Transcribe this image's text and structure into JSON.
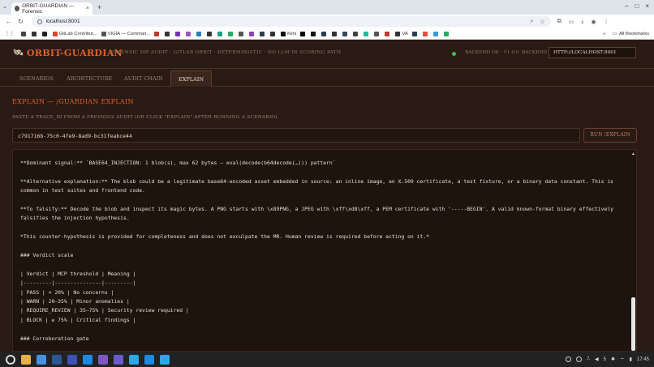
{
  "browser": {
    "tab_title": "ORBIT-GUARDIAN — Forensic",
    "new_tab": "+",
    "url": "localhost:8001",
    "bookmarks": [
      {
        "label": "",
        "color": "#444"
      },
      {
        "label": "",
        "color": "#333"
      },
      {
        "label": "",
        "color": "#222"
      },
      {
        "label": "GitLab Contribut...",
        "color": "#e24329"
      },
      {
        "label": "VIGÍA — Comman...",
        "color": "#555"
      },
      {
        "label": "",
        "color": "#c0392b"
      },
      {
        "label": "",
        "color": "#333"
      },
      {
        "label": "",
        "color": "#7b2fbf"
      },
      {
        "label": "",
        "color": "#9b59b6"
      },
      {
        "label": "",
        "color": "#2980b9"
      },
      {
        "label": "",
        "color": "#333"
      },
      {
        "label": "",
        "color": "#16a085"
      },
      {
        "label": "",
        "color": "#27ae60"
      },
      {
        "label": "",
        "color": "#555"
      },
      {
        "label": "",
        "color": "#8e44ad"
      },
      {
        "label": "",
        "color": "#2c3e50"
      },
      {
        "label": "",
        "color": "#333"
      },
      {
        "label": "Kimi",
        "color": "#111"
      },
      {
        "label": "",
        "color": "#000"
      },
      {
        "label": "",
        "color": "#111"
      },
      {
        "label": "",
        "color": "#2c3e50"
      },
      {
        "label": "",
        "color": "#333"
      },
      {
        "label": "",
        "color": "#34495e"
      },
      {
        "label": "",
        "color": "#444"
      },
      {
        "label": "",
        "color": "#1abc9c"
      },
      {
        "label": "",
        "color": "#555"
      },
      {
        "label": "",
        "color": "#c0392b"
      },
      {
        "label": "VA",
        "color": "#333"
      },
      {
        "label": "",
        "color": "#2c3e50"
      },
      {
        "label": "",
        "color": "#e74c3c"
      },
      {
        "label": "",
        "color": "#3498db"
      },
      {
        "label": "",
        "color": "#27ae60"
      }
    ],
    "all_bookmarks": "All Bookmarks"
  },
  "app": {
    "logo": "ORBIT-GUARDIAN",
    "subtitle": "FORENSIC MR AUDIT · GITLAB ORBIT · DETERMINISTIC · NO LLM IN SCORING PATH",
    "status": "BACKEND OK · V1.0.0",
    "backend_label": "BACKEND",
    "backend_url": "HTTP://LOCALHOST:8001",
    "tabs": [
      "SCENARIOS",
      "ARCHITECTURE",
      "AUDIT CHAIN",
      "EXPLAIN"
    ],
    "active_tab": "EXPLAIN"
  },
  "explain": {
    "title": "EXPLAIN — /GUARDIAN EXPLAIN",
    "hint": "PASTE A TRACE_ID FROM A PREVIOUS AUDIT (OR CLICK \"EXPLAIN\" AFTER RUNNING A SCENARIO).",
    "trace_id": "c791716b-75c0-4fe9-8ad9-bc31feabce44",
    "run_button": "RUN /EXPLAIN",
    "output": [
      "**Dominant signal:** `BASE64_INJECTION: 1 blob(s), max 62 bytes — eval(decode(b64decode(…))) pattern`",
      "",
      "**Alternative explanation:** The blob could be a legitimate base64-encoded asset embedded in source: an inline image, an X.509 certificate, a test fixture, or a binary data constant. This is common in test suites and frontend code.",
      "",
      "**To falsify:** Decode the blob and inspect its magic bytes. A PNG starts with \\x89PNG, a JPEG with \\xff\\xd8\\xff, a PEM certificate with '-----BEGIN'. A valid known-format binary effectively falsifies the injection hypothesis.",
      "",
      "*This counter-hypothesis is provided for completeness and does not exculpate the MR. Human review is required before acting on it.*",
      "",
      "### Verdict scale",
      "",
      "| Verdict | MCP threshold | Meaning |",
      "|---------|---------------|---------|",
      "| PASS | < 20% | No concerns |",
      "| WARN | 20–35% | Minor anomalies |",
      "| REQUIRE_REVIEW | 35–75% | Security review required |",
      "| BLOCK | ≥ 75% | Critical findings |",
      "",
      "### Corroboration gate"
    ]
  },
  "taskbar": {
    "icons": [
      "#3a7bd5",
      "#e8b04a",
      "#4a90e2",
      "#2b5797",
      "#3f51b5",
      "#1e88e5",
      "#7e57c2",
      "#6a5acd",
      "#29a9ea",
      "#1e88e5",
      "#29a9ea"
    ],
    "tray_text": "5",
    "clock": "17:45"
  }
}
